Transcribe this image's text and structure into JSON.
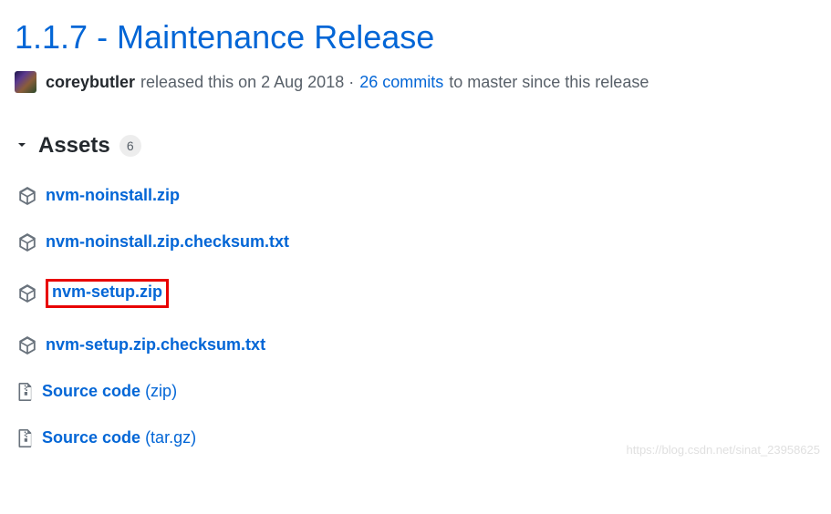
{
  "release": {
    "title": "1.1.7 - Maintenance Release",
    "author": "coreybutler",
    "released_text": "released this on 2 Aug 2018 ·",
    "commits_link": "26 commits",
    "trailing_text": "to master since this release"
  },
  "assets": {
    "label": "Assets",
    "count": "6",
    "items": [
      {
        "name": "nvm-noinstall.zip",
        "icon": "package",
        "highlighted": false
      },
      {
        "name": "nvm-noinstall.zip.checksum.txt",
        "icon": "package",
        "highlighted": false
      },
      {
        "name": "nvm-setup.zip",
        "icon": "package",
        "highlighted": true
      },
      {
        "name": "nvm-setup.zip.checksum.txt",
        "icon": "package",
        "highlighted": false
      },
      {
        "name": "Source code",
        "suffix": "(zip)",
        "icon": "zip",
        "highlighted": false
      },
      {
        "name": "Source code",
        "suffix": "(tar.gz)",
        "icon": "zip",
        "highlighted": false
      }
    ]
  },
  "watermark": "https://blog.csdn.net/sinat_23958625"
}
